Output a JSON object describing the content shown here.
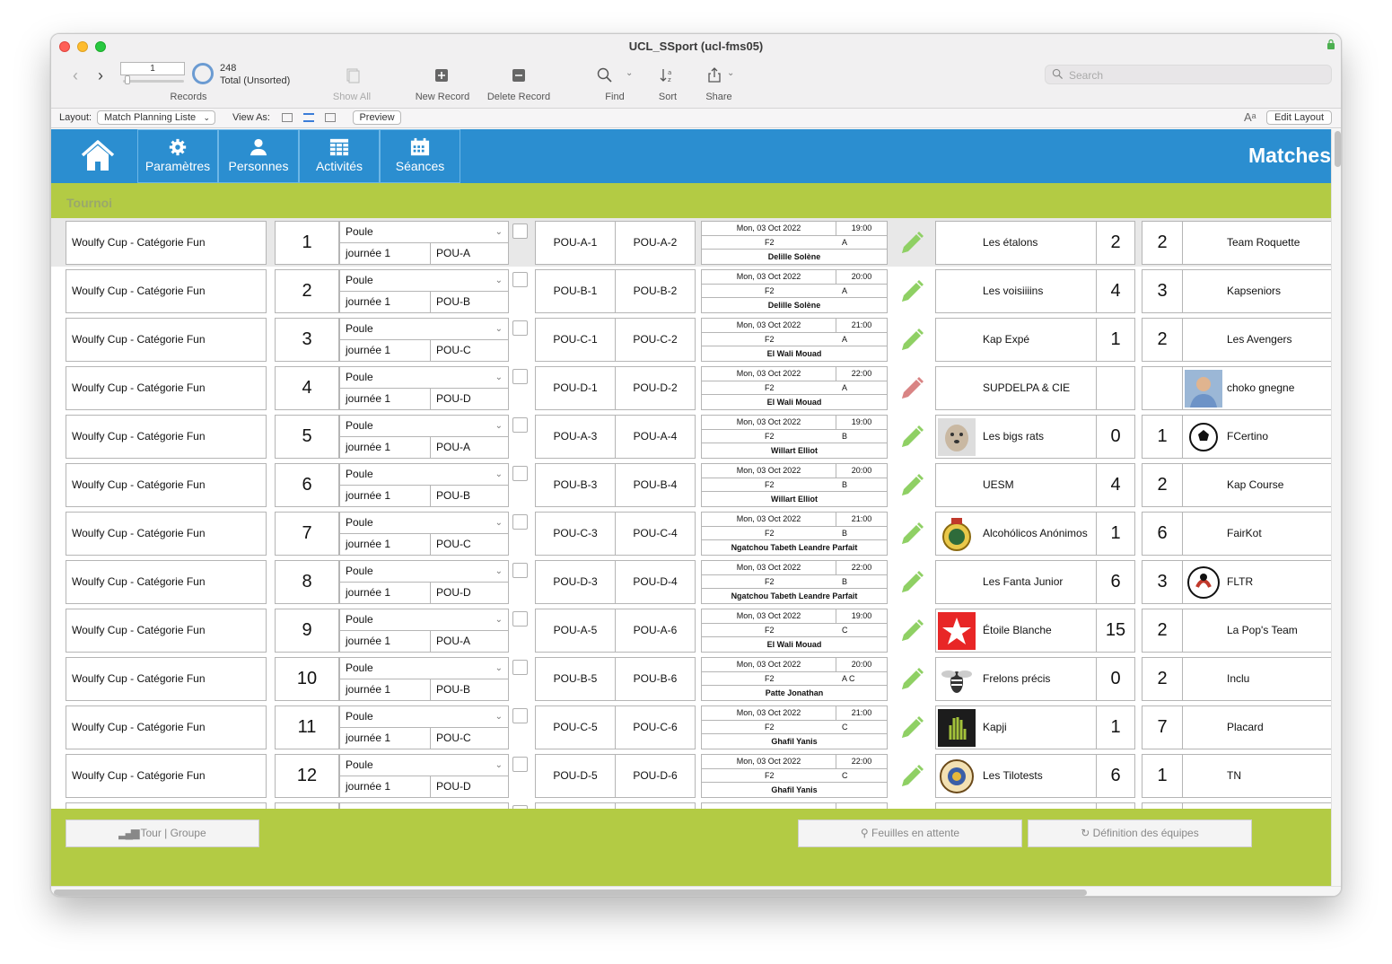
{
  "window": {
    "title": "UCL_SSport (ucl-fms05)"
  },
  "toolbar": {
    "record_value": "1",
    "record_count": "248",
    "record_status": "Total (Unsorted)",
    "records_label": "Records",
    "show_all": "Show All",
    "new_record": "New Record",
    "delete_record": "Delete Record",
    "find": "Find",
    "sort": "Sort",
    "share": "Share",
    "search_placeholder": "Search"
  },
  "layoutbar": {
    "layout_label": "Layout:",
    "layout_value": "Match Planning Liste",
    "view_as_label": "View As:",
    "preview": "Preview",
    "edit_layout": "Edit Layout"
  },
  "nav": {
    "items": [
      {
        "label": "Paramètres",
        "icon": "gear-icon"
      },
      {
        "label": "Personnes",
        "icon": "person-icon"
      },
      {
        "label": "Activités",
        "icon": "table-icon"
      },
      {
        "label": "Séances",
        "icon": "calendar-icon"
      }
    ],
    "title": "Matches"
  },
  "section": {
    "title": "Tournoi"
  },
  "matches": [
    {
      "tournament": "Woulfy Cup - Catégorie Fun",
      "num": "1",
      "type": "Poule",
      "day": "journée 1",
      "group": "POU-A",
      "slot1": "POU-A-1",
      "slot2": "POU-A-2",
      "date": "Mon, 03 Oct 2022",
      "time": "19:00",
      "field": "F2",
      "field2": "A",
      "referee": "Delille Solène",
      "pencil": "green",
      "home": "Les étalons",
      "home_logo": "",
      "score1": "2",
      "score2": "2",
      "away": "Team Roquette",
      "away_logo": ""
    },
    {
      "tournament": "Woulfy Cup - Catégorie Fun",
      "num": "2",
      "type": "Poule",
      "day": "journée 1",
      "group": "POU-B",
      "slot1": "POU-B-1",
      "slot2": "POU-B-2",
      "date": "Mon, 03 Oct 2022",
      "time": "20:00",
      "field": "F2",
      "field2": "A",
      "referee": "Delille Solène",
      "pencil": "green",
      "home": "Les voisiiiins",
      "home_logo": "",
      "score1": "4",
      "score2": "3",
      "away": "Kapseniors",
      "away_logo": ""
    },
    {
      "tournament": "Woulfy Cup - Catégorie Fun",
      "num": "3",
      "type": "Poule",
      "day": "journée 1",
      "group": "POU-C",
      "slot1": "POU-C-1",
      "slot2": "POU-C-2",
      "date": "Mon, 03 Oct 2022",
      "time": "21:00",
      "field": "F2",
      "field2": "A",
      "referee": "El Wali Mouad",
      "pencil": "green",
      "home": "Kap Expé",
      "home_logo": "",
      "score1": "1",
      "score2": "2",
      "away": "Les Avengers",
      "away_logo": ""
    },
    {
      "tournament": "Woulfy Cup - Catégorie Fun",
      "num": "4",
      "type": "Poule",
      "day": "journée 1",
      "group": "POU-D",
      "slot1": "POU-D-1",
      "slot2": "POU-D-2",
      "date": "Mon, 03 Oct 2022",
      "time": "22:00",
      "field": "F2",
      "field2": "A",
      "referee": "El Wali Mouad",
      "pencil": "red",
      "home": "SUPDELPA & CIE",
      "home_logo": "",
      "score1": "",
      "score2": "",
      "away": "choko gnegne",
      "away_logo": "photo"
    },
    {
      "tournament": "Woulfy Cup - Catégorie Fun",
      "num": "5",
      "type": "Poule",
      "day": "journée 1",
      "group": "POU-A",
      "slot1": "POU-A-3",
      "slot2": "POU-A-4",
      "date": "Mon, 03 Oct 2022",
      "time": "19:00",
      "field": "F2",
      "field2": "B",
      "referee": "Willart Elliot",
      "pencil": "green",
      "home": "Les bigs rats",
      "home_logo": "dog",
      "score1": "0",
      "score2": "1",
      "away": "FCertino",
      "away_logo": "ball"
    },
    {
      "tournament": "Woulfy Cup - Catégorie Fun",
      "num": "6",
      "type": "Poule",
      "day": "journée 1",
      "group": "POU-B",
      "slot1": "POU-B-3",
      "slot2": "POU-B-4",
      "date": "Mon, 03 Oct 2022",
      "time": "20:00",
      "field": "F2",
      "field2": "B",
      "referee": "Willart Elliot",
      "pencil": "green",
      "home": "UESM",
      "home_logo": "",
      "score1": "4",
      "score2": "2",
      "away": "Kap Course",
      "away_logo": ""
    },
    {
      "tournament": "Woulfy Cup - Catégorie Fun",
      "num": "7",
      "type": "Poule",
      "day": "journée 1",
      "group": "POU-C",
      "slot1": "POU-C-3",
      "slot2": "POU-C-4",
      "date": "Mon, 03 Oct 2022",
      "time": "21:00",
      "field": "F2",
      "field2": "B",
      "referee": "Ngatchou Tabeth Leandre Parfait",
      "pencil": "green",
      "home": "Alcohólicos Anónimos",
      "home_logo": "crest",
      "score1": "1",
      "score2": "6",
      "away": "FairKot",
      "away_logo": ""
    },
    {
      "tournament": "Woulfy Cup - Catégorie Fun",
      "num": "8",
      "type": "Poule",
      "day": "journée 1",
      "group": "POU-D",
      "slot1": "POU-D-3",
      "slot2": "POU-D-4",
      "date": "Mon, 03 Oct 2022",
      "time": "22:00",
      "field": "F2",
      "field2": "B",
      "referee": "Ngatchou Tabeth Leandre Parfait",
      "pencil": "green",
      "home": "Les Fanta Junior",
      "home_logo": "",
      "score1": "6",
      "score2": "3",
      "away": "FLTR",
      "away_logo": "badge"
    },
    {
      "tournament": "Woulfy Cup - Catégorie Fun",
      "num": "9",
      "type": "Poule",
      "day": "journée 1",
      "group": "POU-A",
      "slot1": "POU-A-5",
      "slot2": "POU-A-6",
      "date": "Mon, 03 Oct 2022",
      "time": "19:00",
      "field": "F2",
      "field2": "C",
      "referee": "El Wali Mouad",
      "pencil": "green",
      "home": "Étoile Blanche",
      "home_logo": "star",
      "score1": "15",
      "score2": "2",
      "away": "La Pop's Team",
      "away_logo": ""
    },
    {
      "tournament": "Woulfy Cup - Catégorie Fun",
      "num": "10",
      "type": "Poule",
      "day": "journée 1",
      "group": "POU-B",
      "slot1": "POU-B-5",
      "slot2": "POU-B-6",
      "date": "Mon, 03 Oct 2022",
      "time": "20:00",
      "field": "F2",
      "field2": "A C",
      "referee": "Patte Jonathan",
      "pencil": "green",
      "home": "Frelons précis",
      "home_logo": "hornet",
      "score1": "0",
      "score2": "2",
      "away": "Inclu",
      "away_logo": ""
    },
    {
      "tournament": "Woulfy Cup - Catégorie Fun",
      "num": "11",
      "type": "Poule",
      "day": "journée 1",
      "group": "POU-C",
      "slot1": "POU-C-5",
      "slot2": "POU-C-6",
      "date": "Mon, 03 Oct 2022",
      "time": "21:00",
      "field": "F2",
      "field2": "C",
      "referee": "Ghafil Yanis",
      "pencil": "green",
      "home": "Kapji",
      "home_logo": "hand",
      "score1": "1",
      "score2": "7",
      "away": "Placard",
      "away_logo": ""
    },
    {
      "tournament": "Woulfy Cup - Catégorie Fun",
      "num": "12",
      "type": "Poule",
      "day": "journée 1",
      "group": "POU-D",
      "slot1": "POU-D-5",
      "slot2": "POU-D-6",
      "date": "Mon, 03 Oct 2022",
      "time": "22:00",
      "field": "F2",
      "field2": "C",
      "referee": "Ghafil Yanis",
      "pencil": "green",
      "home": "Les Tilotests",
      "home_logo": "seal",
      "score1": "6",
      "score2": "1",
      "away": "TN",
      "away_logo": ""
    }
  ],
  "footer": {
    "tour_groupe": "Tour | Groupe",
    "feuilles": "Feuilles en attente",
    "definition": "Définition des équipes"
  },
  "colors": {
    "nav_blue": "#2b8ed0",
    "green_bar": "#b3cb44",
    "pencil_green": "#8fd064",
    "pencil_red": "#d98484"
  }
}
